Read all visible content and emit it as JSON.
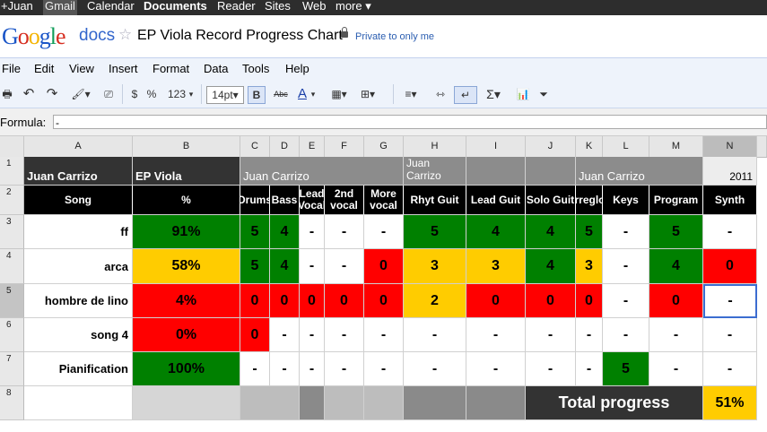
{
  "topbar": {
    "user": "+Juan",
    "links": [
      "Gmail",
      "Calendar",
      "Documents",
      "Reader",
      "Sites",
      "Web",
      "more ▾"
    ]
  },
  "header": {
    "logo": "Google",
    "product": "docs",
    "title": "EP Viola Record Progress Chart",
    "privacy": "Private to only me"
  },
  "menu": [
    "File",
    "Edit",
    "View",
    "Insert",
    "Format",
    "Data",
    "Tools",
    "Help"
  ],
  "toolbar": {
    "currency": "$",
    "percent": "%",
    "number_format": "123",
    "font_size": "14pt",
    "bold": "B",
    "strike": "Abc",
    "text_color": "A",
    "sum": "Σ"
  },
  "formula": {
    "label": "Formula:",
    "value": "-"
  },
  "columns": [
    "A",
    "B",
    "C",
    "D",
    "E",
    "F",
    "G",
    "H",
    "I",
    "J",
    "K",
    "L",
    "M",
    "N"
  ],
  "rows": [
    "1",
    "2",
    "3",
    "4",
    "5",
    "6",
    "7",
    "8"
  ],
  "row1": {
    "a": "Juan Carrizo",
    "b": "EP Viola",
    "c": "Juan Carrizo",
    "h": "Juan Carrizo",
    "k": "Juan Carrizo",
    "n": "2011"
  },
  "headers": [
    "Song",
    "%",
    "Drums",
    "Bass",
    "Lead Vocal",
    "2nd vocal",
    "More vocal",
    "Rhyt Guit",
    "Lead Guit",
    "Solo Guit",
    "Arreglos",
    "Keys",
    "Program",
    "Synth"
  ],
  "songs": [
    {
      "name": "ff",
      "pct": "91%",
      "vals": [
        "5",
        "4",
        "-",
        "-",
        "-",
        "5",
        "4",
        "4",
        "5",
        "-",
        "5",
        "-"
      ]
    },
    {
      "name": "arca",
      "pct": "58%",
      "vals": [
        "5",
        "4",
        "-",
        "-",
        "0",
        "3",
        "3",
        "4",
        "3",
        "-",
        "4",
        "0"
      ]
    },
    {
      "name": "hombre de lino",
      "pct": "4%",
      "vals": [
        "0",
        "0",
        "0",
        "0",
        "0",
        "2",
        "0",
        "0",
        "0",
        "-",
        "0",
        "-"
      ]
    },
    {
      "name": "song 4",
      "pct": "0%",
      "vals": [
        "0",
        "-",
        "-",
        "-",
        "-",
        "-",
        "-",
        "-",
        "-",
        "-",
        "-",
        "-"
      ]
    },
    {
      "name": "Pianification",
      "pct": "100%",
      "vals": [
        "-",
        "-",
        "-",
        "-",
        "-",
        "-",
        "-",
        "-",
        "-",
        "5",
        "-",
        "-"
      ]
    }
  ],
  "total": {
    "label": "Total progress",
    "value": "51%"
  },
  "colors": {
    "green": "#008000",
    "yellow": "#ffcc00",
    "red": "#ff0000",
    "white": "#ffffff"
  }
}
